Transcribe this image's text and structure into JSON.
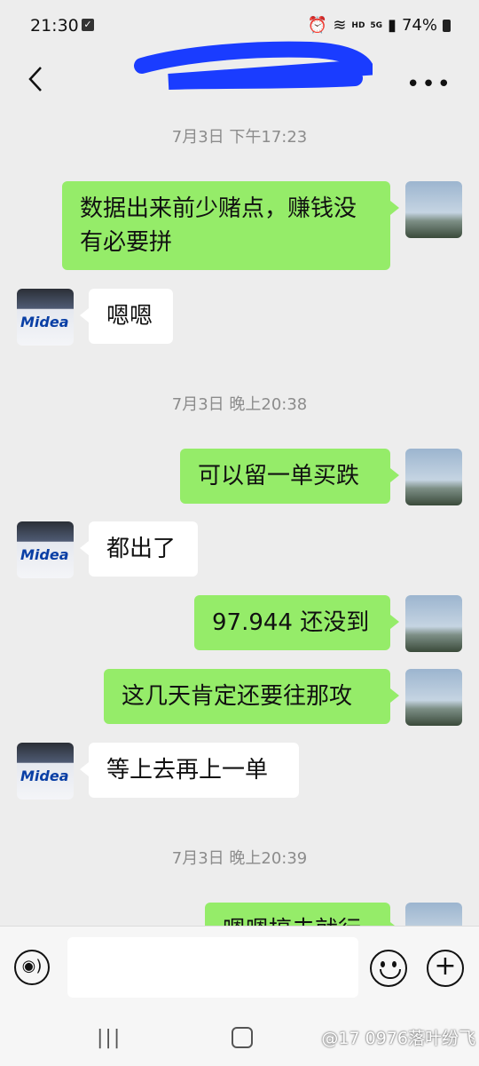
{
  "status": {
    "time": "21:30",
    "signal_label": "HD",
    "network": "5G",
    "battery": "74%"
  },
  "header": {
    "title": ""
  },
  "messages": {
    "ts1": "7月3日 下午17:23",
    "m1": "数据出来前少赌点，赚钱没有必要拼",
    "m2": "嗯嗯",
    "ts2": "7月3日 晚上20:38",
    "m3": "可以留一单买跌",
    "m4": "都出了",
    "m5": "97.944 还没到",
    "m6": "这几天肯定还要往那攻",
    "m7": "等上去再上一单",
    "ts3": "7月3日 晚上20:39",
    "m8": "嗯嗯搞去就行"
  },
  "peer_avatar_text": "Midea",
  "input": {
    "placeholder": ""
  },
  "watermark": "@17 0976落叶纷飞",
  "colors": {
    "self_bubble": "#95ec69",
    "peer_bubble": "#ffffff",
    "background": "#ededed"
  }
}
